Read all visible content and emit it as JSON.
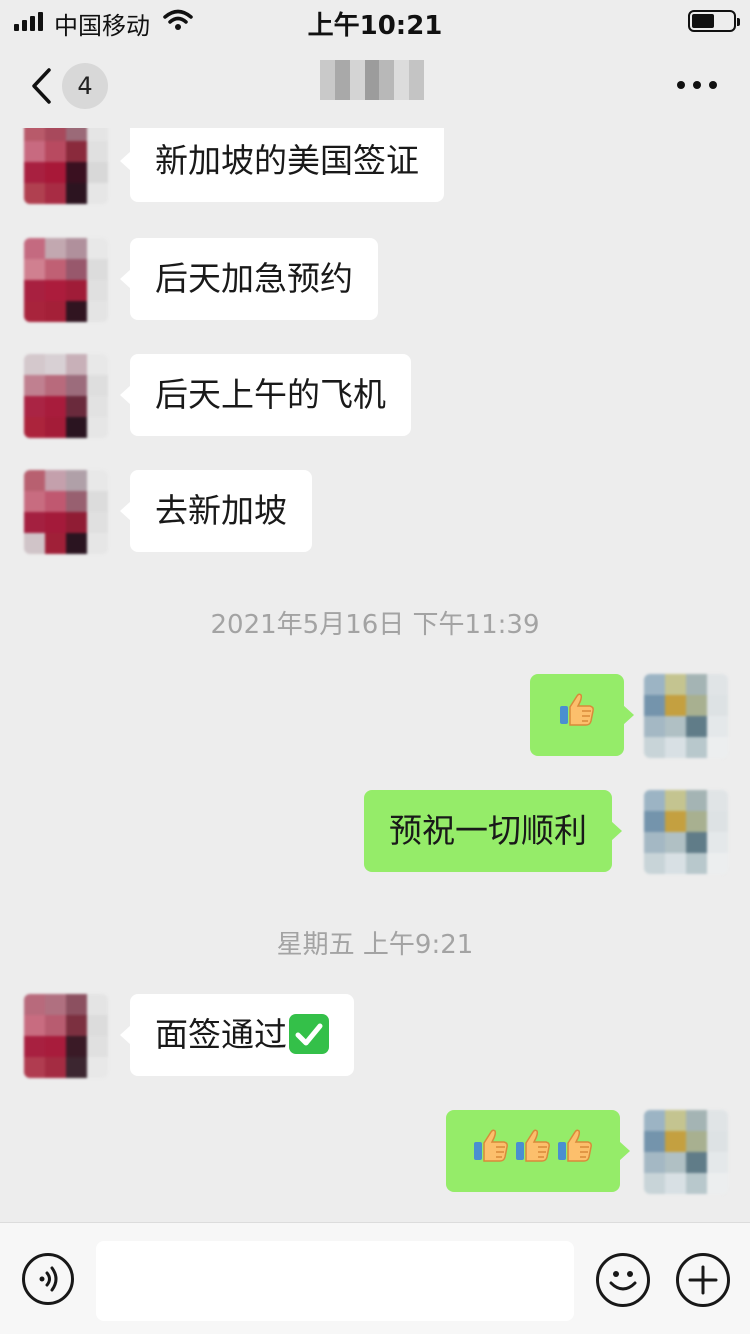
{
  "status_bar": {
    "carrier": "中国移动",
    "time": "上午10:21",
    "signal_bars": 4,
    "battery_level": 0.55
  },
  "nav": {
    "unread_count": "4",
    "back_icon": "chevron-left-icon",
    "more_icon": "more-dots-icon"
  },
  "messages": [
    {
      "side": "in",
      "text": "新加坡的美国签证"
    },
    {
      "side": "in",
      "text": "后天加急预约"
    },
    {
      "side": "in",
      "text": "后天上午的飞机"
    },
    {
      "side": "in",
      "text": "去新加坡"
    },
    {
      "side": "time",
      "text": "2021年5月16日 下午11:39"
    },
    {
      "side": "out",
      "emoji": "thumbs-up",
      "count": 1
    },
    {
      "side": "out",
      "text": "预祝一切顺利"
    },
    {
      "side": "time",
      "text": "星期五 上午9:21"
    },
    {
      "side": "in",
      "text": "面签通过",
      "emoji": "check-mark-button"
    },
    {
      "side": "out",
      "emoji": "thumbs-up",
      "count": 3
    }
  ],
  "input_bar": {
    "voice_icon": "voice-icon",
    "emoji_icon": "emoji-icon",
    "plus_icon": "plus-icon",
    "text_value": ""
  },
  "colors": {
    "background": "#ededed",
    "incoming_bubble": "#ffffff",
    "outgoing_bubble": "#95ec69",
    "timestamp": "#a3a3a3"
  }
}
